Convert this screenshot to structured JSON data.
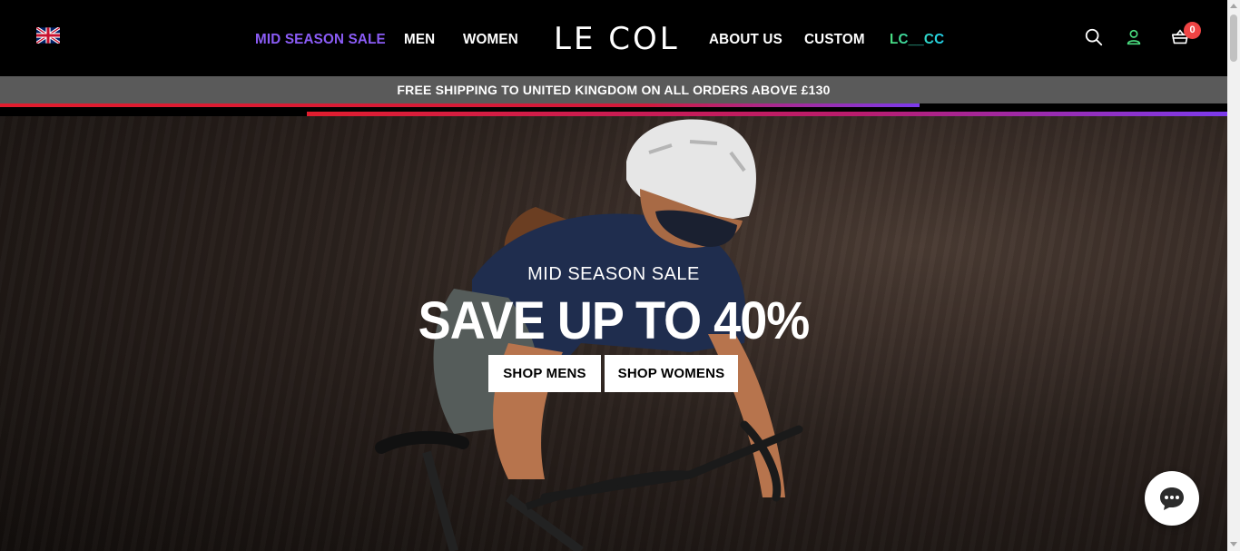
{
  "header": {
    "flag_icon": "uk-flag-icon",
    "nav": {
      "sale": "MID SEASON SALE",
      "men": "MEN",
      "women": "WOMEN",
      "about": "ABOUT US",
      "custom": "CUSTOM",
      "lccc": "LC__CC"
    },
    "logo": "LE COL",
    "icons": [
      "search-icon",
      "account-icon",
      "cart-icon"
    ],
    "cart_count": "0",
    "colors": {
      "sale": "#8b5cf6",
      "background": "#000000",
      "badge": "#ef4444"
    }
  },
  "shipping_banner": "FREE SHIPPING TO UNITED KINGDOM ON ALL ORDERS ABOVE £130",
  "hero": {
    "eyebrow": "MID SEASON SALE",
    "headline": "SAVE UP TO 40%",
    "buttons": {
      "mens": "SHOP MENS",
      "womens": "SHOP WOMENS"
    }
  },
  "chat": {
    "icon": "chat-bubble-icon"
  }
}
